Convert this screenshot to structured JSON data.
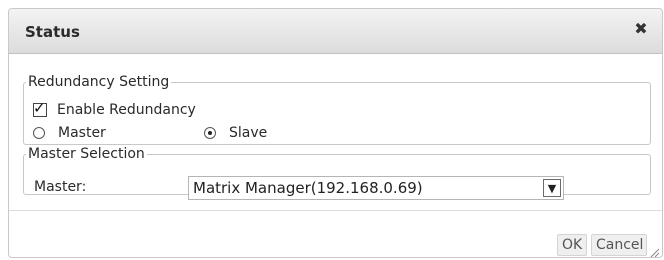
{
  "dialog": {
    "title": "Status",
    "close_icon": "close-icon",
    "redundancy": {
      "legend": "Redundancy Setting",
      "enable_label": "Enable Redundancy",
      "enable_checked": true,
      "master_label": "Master",
      "slave_label": "Slave",
      "selected_role": "Slave"
    },
    "master_selection": {
      "legend": "Master Selection",
      "master_label": "Master:",
      "selected_value": "Matrix Manager(192.168.0.69)"
    },
    "buttons": {
      "ok": "OK",
      "cancel": "Cancel"
    }
  }
}
